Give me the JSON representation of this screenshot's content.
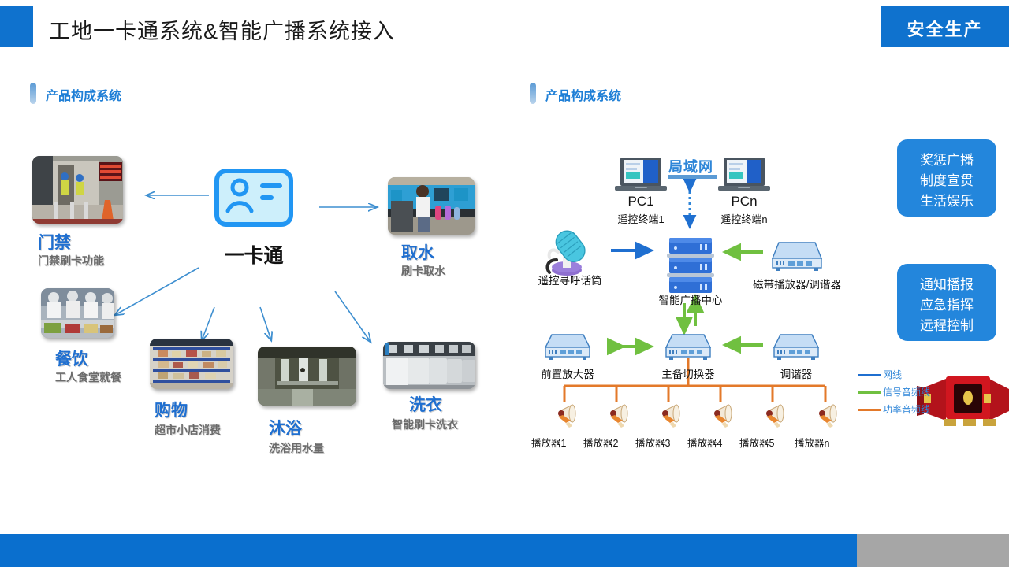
{
  "header": {
    "title": "工地一卡通系统&智能广播系统接入",
    "badge": "安全生产",
    "accent_color": "#0F72CE"
  },
  "sections": {
    "left_title": "产品构成系统",
    "right_title": "产品构成系统"
  },
  "left_panel": {
    "center": {
      "label": "一卡通",
      "icon": "id-card-icon"
    },
    "nodes": [
      {
        "title": "门禁",
        "subtitle": "门禁刷卡功能",
        "photo": "access-gate-photo"
      },
      {
        "title": "餐饮",
        "subtitle": "工人食堂就餐",
        "photo": "canteen-photo"
      },
      {
        "title": "购物",
        "subtitle": "超市小店消费",
        "photo": "supermarket-photo"
      },
      {
        "title": "沐浴",
        "subtitle": "洗浴用水量",
        "photo": "shower-room-photo"
      },
      {
        "title": "洗衣",
        "subtitle": "智能刷卡洗衣",
        "photo": "laundry-photo"
      },
      {
        "title": "取水",
        "subtitle": "刷卡取水",
        "photo": "water-station-photo"
      }
    ]
  },
  "right_panel": {
    "lan_label": "局域网",
    "terminals": [
      {
        "name": "PC1",
        "sub": "遥控终端1"
      },
      {
        "name": "PCn",
        "sub": "遥控终端n"
      }
    ],
    "devices": {
      "microphone": "遥控寻呼话筒",
      "broadcast_center": "智能广播中心",
      "tape_tuner": "磁带播放器/调谐器",
      "preamp": "前置放大器",
      "switcher": "主备切换器",
      "tuner": "调谐器"
    },
    "speakers": [
      "播放器1",
      "播放器2",
      "播放器3",
      "播放器4",
      "播放器5",
      "播放器n"
    ],
    "callouts": [
      {
        "lines": [
          "奖惩广播",
          "制度宣贯",
          "生活娱乐"
        ]
      },
      {
        "lines": [
          "通知播报",
          "应急指挥",
          "远程控制"
        ]
      }
    ],
    "legend": [
      {
        "label": "网线",
        "color": "#1F6FD0"
      },
      {
        "label": "信号音频线",
        "color": "#70C040"
      },
      {
        "label": "功率音频线",
        "color": "#E3792A"
      }
    ],
    "horn": "red-horn-cluster-icon"
  },
  "footer": {
    "left_color": "#0A6FCE",
    "right_color": "#A6A6A6"
  }
}
